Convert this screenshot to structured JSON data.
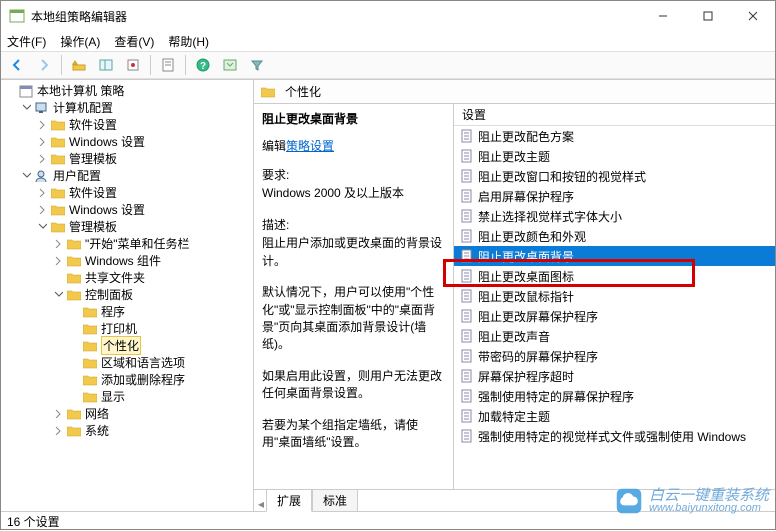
{
  "window": {
    "title": "本地组策略编辑器"
  },
  "menus": {
    "file": "文件(F)",
    "action": "操作(A)",
    "view": "查看(V)",
    "help": "帮助(H)"
  },
  "tree": [
    {
      "d": 0,
      "exp": "",
      "label": "本地计算机 策略",
      "icon": "book"
    },
    {
      "d": 1,
      "exp": "-",
      "label": "计算机配置",
      "icon": "pc"
    },
    {
      "d": 2,
      "exp": ">",
      "label": "软件设置",
      "icon": "folder"
    },
    {
      "d": 2,
      "exp": ">",
      "label": "Windows 设置",
      "icon": "folder"
    },
    {
      "d": 2,
      "exp": ">",
      "label": "管理模板",
      "icon": "folder"
    },
    {
      "d": 1,
      "exp": "-",
      "label": "用户配置",
      "icon": "user"
    },
    {
      "d": 2,
      "exp": ">",
      "label": "软件设置",
      "icon": "folder"
    },
    {
      "d": 2,
      "exp": ">",
      "label": "Windows 设置",
      "icon": "folder"
    },
    {
      "d": 2,
      "exp": "-",
      "label": "管理模板",
      "icon": "folder"
    },
    {
      "d": 3,
      "exp": ">",
      "label": "\"开始\"菜单和任务栏",
      "icon": "folder"
    },
    {
      "d": 3,
      "exp": ">",
      "label": "Windows 组件",
      "icon": "folder"
    },
    {
      "d": 3,
      "exp": "",
      "label": "共享文件夹",
      "icon": "folder"
    },
    {
      "d": 3,
      "exp": "-",
      "label": "控制面板",
      "icon": "folder"
    },
    {
      "d": 4,
      "exp": "",
      "label": "程序",
      "icon": "folder"
    },
    {
      "d": 4,
      "exp": "",
      "label": "打印机",
      "icon": "folder"
    },
    {
      "d": 4,
      "exp": "",
      "label": "个性化",
      "icon": "folder",
      "selected": true
    },
    {
      "d": 4,
      "exp": "",
      "label": "区域和语言选项",
      "icon": "folder"
    },
    {
      "d": 4,
      "exp": "",
      "label": "添加或删除程序",
      "icon": "folder"
    },
    {
      "d": 4,
      "exp": "",
      "label": "显示",
      "icon": "folder"
    },
    {
      "d": 3,
      "exp": ">",
      "label": "网络",
      "icon": "folder"
    },
    {
      "d": 3,
      "exp": ">",
      "label": "系统",
      "icon": "folder"
    }
  ],
  "header": {
    "title": "个性化"
  },
  "detail": {
    "title": "阻止更改桌面背景",
    "edit_link_prefix": "编辑",
    "edit_link": "策略设置",
    "req_label": "要求:",
    "req_body": "Windows 2000 及以上版本",
    "desc_label": "描述:",
    "desc1": "阻止用户添加或更改桌面的背景设计。",
    "desc2": "默认情况下，用户可以使用\"个性化\"或\"显示控制面板\"中的\"桌面背景\"页向其桌面添加背景设计(墙纸)。",
    "desc3": "如果启用此设置，则用户无法更改任何桌面背景设置。",
    "desc4": "若要为某个组指定墙纸，请使用\"桌面墙纸\"设置。"
  },
  "listHeader": "设置",
  "settings": [
    "阻止更改配色方案",
    "阻止更改主题",
    "阻止更改窗口和按钮的视觉样式",
    "启用屏幕保护程序",
    "禁止选择视觉样式字体大小",
    "阻止更改颜色和外观",
    "阻止更改桌面背景",
    "阻止更改桌面图标",
    "阻止更改鼠标指针",
    "阻止更改屏幕保护程序",
    "阻止更改声音",
    "带密码的屏幕保护程序",
    "屏幕保护程序超时",
    "强制使用特定的屏幕保护程序",
    "加载特定主题",
    "强制使用特定的视觉样式文件或强制使用 Windows"
  ],
  "selectedSetting": 6,
  "tabs": {
    "extended": "扩展",
    "standard": "标准"
  },
  "status": "16 个设置",
  "watermark": {
    "brand": "白云一键重装系统",
    "url": "www.baiyunxitong.com"
  }
}
